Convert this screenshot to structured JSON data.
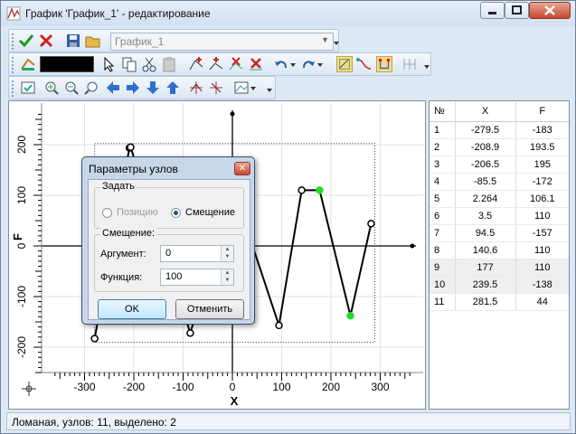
{
  "window": {
    "title": "График 'График_1' - редактирование"
  },
  "toolbar": {
    "file_combo_value": "График_1"
  },
  "chart": {
    "xlabel": "X",
    "ylabel": "F",
    "x_ticks": [
      "-300",
      "-200",
      "-100",
      "0",
      "100",
      "200",
      "300"
    ],
    "y_ticks": [
      "200",
      "100",
      "0",
      "-100",
      "-200"
    ]
  },
  "chart_data": {
    "type": "line",
    "xlabel": "X",
    "ylabel": "F",
    "xlim": [
      -380,
      380
    ],
    "ylim": [
      -270,
      270
    ],
    "x": [
      -279.5,
      -208.9,
      -206.5,
      -85.5,
      2.264,
      3.5,
      94.5,
      140.6,
      177,
      239.5,
      281.5
    ],
    "y": [
      -183,
      193.5,
      195,
      -172,
      106.1,
      110,
      -157,
      110,
      110,
      -138,
      44
    ],
    "selected": [
      8,
      9
    ]
  },
  "table": {
    "headers": [
      "№",
      "X",
      "F"
    ],
    "rows": [
      [
        "1",
        "-279.5",
        "-183"
      ],
      [
        "2",
        "-208.9",
        "193.5"
      ],
      [
        "3",
        "-206.5",
        "195"
      ],
      [
        "4",
        "-85.5",
        "-172"
      ],
      [
        "5",
        "2.264",
        "106.1"
      ],
      [
        "6",
        "3.5",
        "110"
      ],
      [
        "7",
        "94.5",
        "-157"
      ],
      [
        "8",
        "140.6",
        "110"
      ],
      [
        "9",
        "177",
        "110"
      ],
      [
        "10",
        "239.5",
        "-138"
      ],
      [
        "11",
        "281.5",
        "44"
      ]
    ]
  },
  "status": {
    "text": "Ломаная, узлов: 11, выделено: 2"
  },
  "dialog": {
    "title": "Параметры узлов",
    "group_set": "Задать",
    "radio_position": "Позицию",
    "radio_offset": "Смещение",
    "group_offset": "Смещение:",
    "arg_label": "Аргумент:",
    "arg_value": "0",
    "func_label": "Функция:",
    "func_value": "100",
    "ok": "OK",
    "cancel": "Отменить"
  }
}
